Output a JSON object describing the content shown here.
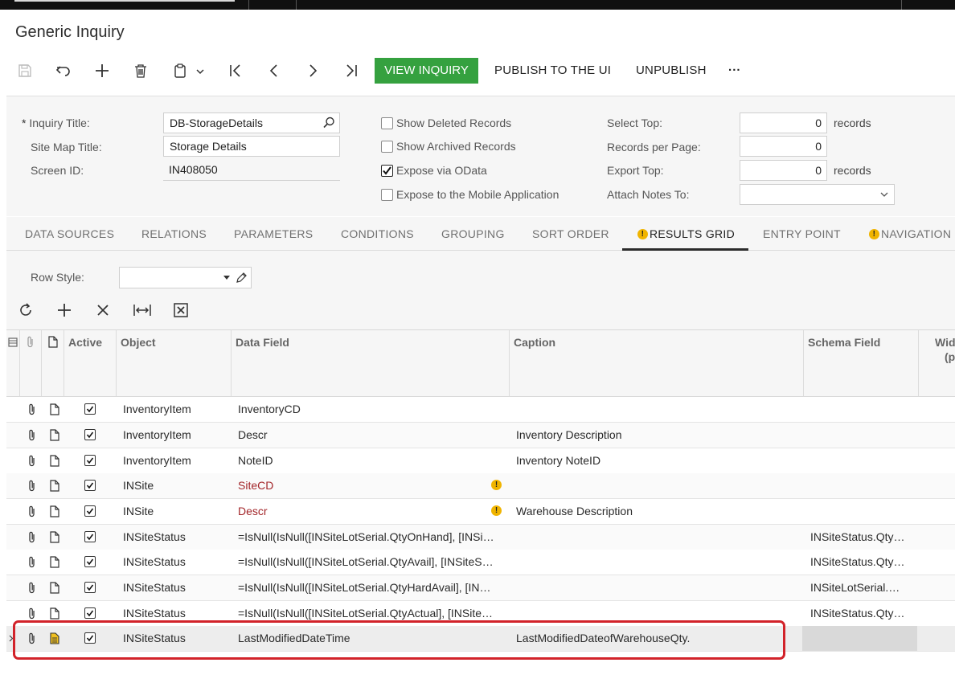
{
  "screen_title": "Generic Inquiry",
  "toolbar": {
    "view_inquiry": "VIEW INQUIRY",
    "publish": "PUBLISH TO THE UI",
    "unpublish": "UNPUBLISH",
    "more": "···"
  },
  "form": {
    "inquiry_title_label": "Inquiry Title:",
    "required_mark": "*",
    "inquiry_title": "DB-StorageDetails",
    "site_map_title_label": "Site Map Title:",
    "site_map_title": "Storage Details",
    "screen_id_label": "Screen ID:",
    "screen_id": "IN408050",
    "show_deleted": {
      "label": "Show Deleted Records",
      "checked": false
    },
    "show_archived": {
      "label": "Show Archived Records",
      "checked": false
    },
    "expose_odata": {
      "label": "Expose via OData",
      "checked": true
    },
    "expose_mobile": {
      "label": "Expose to the Mobile Application",
      "checked": false
    },
    "select_top_label": "Select Top:",
    "select_top": "0",
    "records_suffix": "records",
    "records_per_page_label": "Records per Page:",
    "records_per_page": "0",
    "export_top_label": "Export Top:",
    "export_top": "0",
    "attach_notes_label": "Attach Notes To:",
    "attach_notes": ""
  },
  "tabs": [
    {
      "label": "DATA SOURCES",
      "warn": false
    },
    {
      "label": "RELATIONS",
      "warn": false
    },
    {
      "label": "PARAMETERS",
      "warn": false
    },
    {
      "label": "CONDITIONS",
      "warn": false
    },
    {
      "label": "GROUPING",
      "warn": false
    },
    {
      "label": "SORT ORDER",
      "warn": false
    },
    {
      "label": "RESULTS GRID",
      "warn": true,
      "active": true
    },
    {
      "label": "ENTRY POINT",
      "warn": false
    },
    {
      "label": "NAVIGATION",
      "warn": true
    }
  ],
  "row_style_label": "Row Style:",
  "row_style": "",
  "grid": {
    "headers": {
      "active": "Active",
      "object": "Object",
      "data_field": "Data Field",
      "caption": "Caption",
      "schema_field": "Schema Field",
      "width_a": "Widt",
      "width_b": "(p"
    },
    "rows": [
      {
        "active": true,
        "object": "InventoryItem",
        "data_field": "InventoryCD",
        "caption": "",
        "schema": "",
        "warn": false
      },
      {
        "active": true,
        "object": "InventoryItem",
        "data_field": "Descr",
        "caption": "Inventory Description",
        "schema": "",
        "warn": false
      },
      {
        "active": true,
        "object": "InventoryItem",
        "data_field": "NoteID",
        "caption": "Inventory NoteID",
        "schema": "",
        "warn": false
      },
      {
        "active": true,
        "object": "INSite",
        "data_field": "SiteCD",
        "caption": "",
        "schema": "",
        "warn": true
      },
      {
        "active": true,
        "object": "INSite",
        "data_field": "Descr",
        "caption": "Warehouse Description",
        "schema": "",
        "warn": true
      },
      {
        "active": true,
        "object": "INSiteStatus",
        "data_field": "=IsNull(IsNull([INSiteLotSerial.QtyOnHand], [INSi…",
        "caption": "",
        "schema": "INSiteStatus.Qty…",
        "warn": false
      },
      {
        "active": true,
        "object": "INSiteStatus",
        "data_field": "=IsNull(IsNull([INSiteLotSerial.QtyAvail], [INSiteS…",
        "caption": "",
        "schema": "INSiteStatus.Qty…",
        "warn": false
      },
      {
        "active": true,
        "object": "INSiteStatus",
        "data_field": "=IsNull(IsNull([INSiteLotSerial.QtyHardAvail], [IN…",
        "caption": "",
        "schema": "INSiteLotSerial.…",
        "warn": false
      },
      {
        "active": true,
        "object": "INSiteStatus",
        "data_field": "=IsNull(IsNull([INSiteLotSerial.QtyActual], [INSite…",
        "caption": "",
        "schema": "INSiteStatus.Qty…",
        "warn": false
      },
      {
        "active": true,
        "object": "INSiteStatus",
        "data_field": "LastModifiedDateTime",
        "caption": "LastModifiedDateofWarehouseQty.",
        "schema": "",
        "warn": false,
        "selected": true
      }
    ]
  }
}
